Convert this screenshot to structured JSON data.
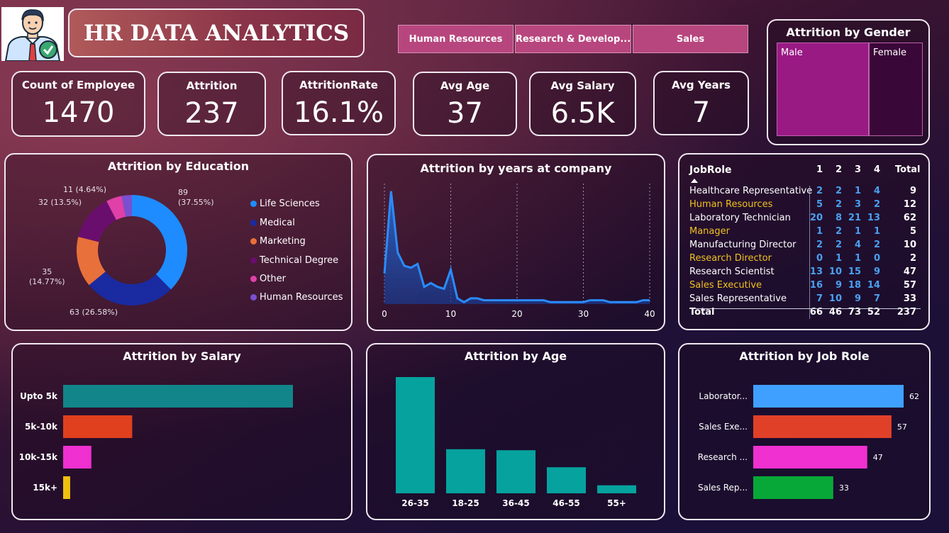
{
  "header": {
    "title": "HR DATA ANALYTICS",
    "logo_icon": "hr-employee-avatar-icon",
    "slicers": [
      "Human Resources",
      "Research & Develop...",
      "Sales"
    ]
  },
  "kpis": [
    {
      "label": "Count of Employee",
      "value": "1470"
    },
    {
      "label": "Attrition",
      "value": "237"
    },
    {
      "label": "AttritionRate",
      "value": "16.1%"
    },
    {
      "label": "Avg Age",
      "value": "37"
    },
    {
      "label": "Avg Salary",
      "value": "6.5K"
    },
    {
      "label": "Avg Years",
      "value": "7"
    }
  ],
  "gender": {
    "title": "Attrition by Gender",
    "male_label": "Male",
    "female_label": "Female"
  },
  "education": {
    "title": "Attrition by Education",
    "labels": {
      "life_sciences": [
        "89",
        "(37.55%)"
      ],
      "medical": "63 (26.58%)",
      "marketing": [
        "35",
        "(14.77%)"
      ],
      "technical": "32 (13.5%)",
      "other": "11 (4.64%)"
    },
    "legend": [
      "Life Sciences",
      "Medical",
      "Marketing",
      "Technical Degree",
      "Other",
      "Human Resources"
    ]
  },
  "years": {
    "title": "Attrition by years at company",
    "ticks": [
      "0",
      "10",
      "20",
      "30",
      "40"
    ]
  },
  "matrix": {
    "header": [
      "JobRole",
      "1",
      "2",
      "3",
      "4",
      "Total"
    ],
    "rows": [
      {
        "role": "Healthcare Representative",
        "vals": [
          "2",
          "2",
          "1",
          "4"
        ],
        "total": "9",
        "highlight": false
      },
      {
        "role": "Human Resources",
        "vals": [
          "5",
          "2",
          "3",
          "2"
        ],
        "total": "12",
        "highlight": true
      },
      {
        "role": "Laboratory Technician",
        "vals": [
          "20",
          "8",
          "21",
          "13"
        ],
        "total": "62",
        "highlight": false
      },
      {
        "role": "Manager",
        "vals": [
          "1",
          "2",
          "1",
          "1"
        ],
        "total": "5",
        "highlight": true
      },
      {
        "role": "Manufacturing Director",
        "vals": [
          "2",
          "2",
          "4",
          "2"
        ],
        "total": "10",
        "highlight": false
      },
      {
        "role": "Research Director",
        "vals": [
          "0",
          "1",
          "1",
          "0"
        ],
        "total": "2",
        "highlight": true
      },
      {
        "role": "Research Scientist",
        "vals": [
          "13",
          "10",
          "15",
          "9"
        ],
        "total": "47",
        "highlight": false
      },
      {
        "role": "Sales Executive",
        "vals": [
          "16",
          "9",
          "18",
          "14"
        ],
        "total": "57",
        "highlight": true
      },
      {
        "role": "Sales Representative",
        "vals": [
          "7",
          "10",
          "9",
          "7"
        ],
        "total": "33",
        "highlight": false
      }
    ],
    "total_row": {
      "role": "Total",
      "vals": [
        "66",
        "46",
        "73",
        "52"
      ],
      "total": "237"
    }
  },
  "salary": {
    "title": "Attrition by Salary"
  },
  "age": {
    "title": "Attrition by Age"
  },
  "jobrole": {
    "title": "Attrition by Job Role"
  },
  "colors": {
    "highlight_text": "#f0c020",
    "matrix_number": "#4aa0f0"
  },
  "chart_data": [
    {
      "type": "pie",
      "title": "Attrition by Education",
      "categories": [
        "Life Sciences",
        "Medical",
        "Marketing",
        "Technical Degree",
        "Other",
        "Human Resources"
      ],
      "values": [
        89,
        63,
        35,
        32,
        11,
        7
      ],
      "colors": [
        "#1e8cff",
        "#1a2aa0",
        "#e8703a",
        "#6a0e6e",
        "#e040a8",
        "#7a50d0"
      ],
      "donut": true
    },
    {
      "type": "area",
      "title": "Attrition by years at company",
      "x": [
        0,
        1,
        2,
        3,
        4,
        5,
        6,
        7,
        8,
        9,
        10,
        11,
        12,
        13,
        14,
        15,
        16,
        17,
        18,
        19,
        20,
        21,
        22,
        23,
        24,
        25,
        26,
        27,
        28,
        29,
        30,
        31,
        32,
        33,
        34,
        35,
        36,
        37,
        38,
        39,
        40
      ],
      "y": [
        16,
        59,
        27,
        20,
        19,
        21,
        9,
        11,
        9,
        8,
        18,
        3,
        1,
        3,
        3,
        2,
        2,
        2,
        2,
        2,
        2,
        2,
        2,
        2,
        2,
        1,
        1,
        1,
        1,
        1,
        1,
        2,
        2,
        2,
        1,
        1,
        1,
        1,
        1,
        2,
        2
      ],
      "xlim": [
        0,
        40
      ],
      "ylim": [
        0,
        63
      ],
      "color": "#2a8cff"
    },
    {
      "type": "bar",
      "title": "Attrition by Salary",
      "orientation": "horizontal",
      "categories": [
        "Upto 5k",
        "5k-10k",
        "10k-15k",
        "15k+"
      ],
      "values": [
        163,
        49,
        20,
        5
      ],
      "colors": [
        "#11858a",
        "#e0401e",
        "#f030d0",
        "#f0c010"
      ]
    },
    {
      "type": "bar",
      "title": "Attrition by Age",
      "categories": [
        "26-35",
        "18-25",
        "36-45",
        "46-55",
        "55+"
      ],
      "values": [
        116,
        44,
        43,
        26,
        8
      ],
      "colors": [
        "#06a29e"
      ]
    },
    {
      "type": "bar",
      "title": "Attrition by Job Role",
      "orientation": "horizontal",
      "categories": [
        "Laborator...",
        "Sales Exe...",
        "Research ...",
        "Sales Rep..."
      ],
      "values": [
        62,
        57,
        47,
        33
      ],
      "colors": [
        "#40a0ff",
        "#e04028",
        "#f030d0",
        "#08a838"
      ]
    }
  ]
}
